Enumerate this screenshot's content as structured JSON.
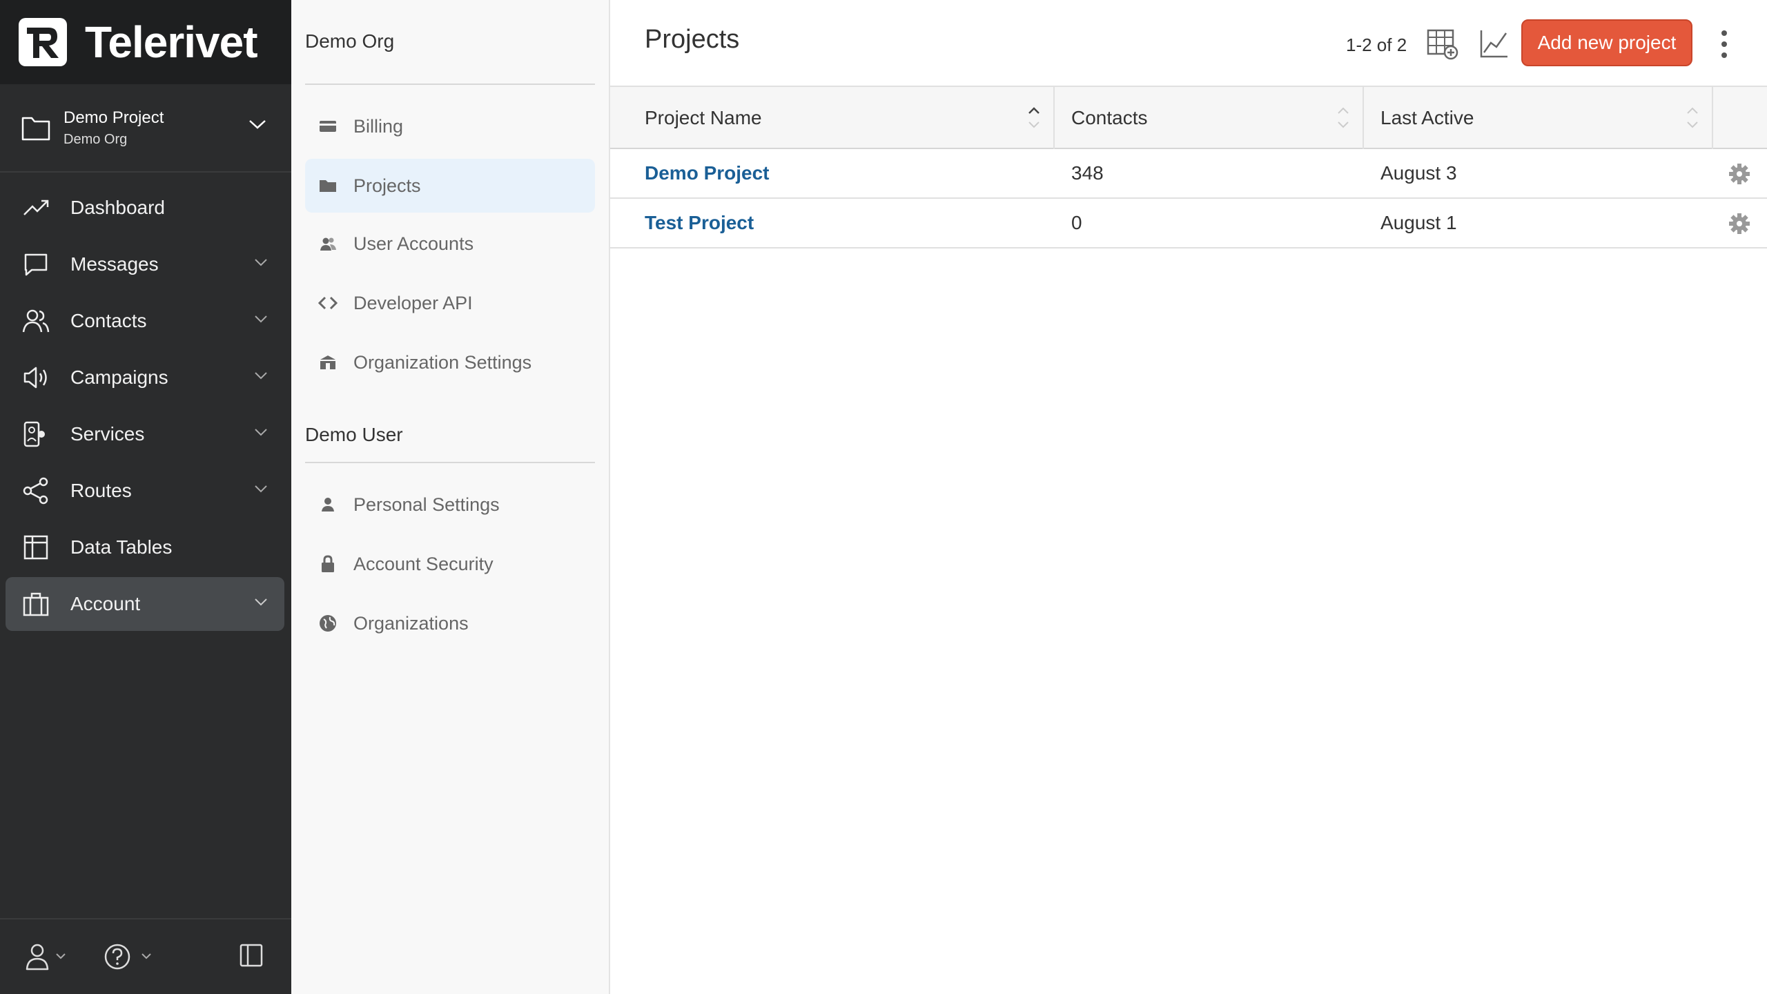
{
  "brand": {
    "name": "Telerivet"
  },
  "project_switcher": {
    "project": "Demo Project",
    "org": "Demo Org"
  },
  "nav": [
    {
      "label": "Dashboard",
      "icon": "trending-up-icon",
      "chevron": false
    },
    {
      "label": "Messages",
      "icon": "chat-icon",
      "chevron": true
    },
    {
      "label": "Contacts",
      "icon": "users-icon",
      "chevron": true
    },
    {
      "label": "Campaigns",
      "icon": "megaphone-icon",
      "chevron": true
    },
    {
      "label": "Services",
      "icon": "services-icon",
      "chevron": true
    },
    {
      "label": "Routes",
      "icon": "share-icon",
      "chevron": true
    },
    {
      "label": "Data Tables",
      "icon": "table-icon",
      "chevron": false
    },
    {
      "label": "Account",
      "icon": "briefcase-icon",
      "chevron": true,
      "active": true
    }
  ],
  "settings": {
    "org_section": "Demo Org",
    "org_items": [
      {
        "label": "Billing",
        "icon": "credit-card-icon"
      },
      {
        "label": "Projects",
        "icon": "folder-icon",
        "active": true
      },
      {
        "label": "User Accounts",
        "icon": "user-group-icon"
      },
      {
        "label": "Developer API",
        "icon": "code-icon"
      },
      {
        "label": "Organization Settings",
        "icon": "building-icon"
      }
    ],
    "user_section": "Demo User",
    "user_items": [
      {
        "label": "Personal Settings",
        "icon": "person-icon"
      },
      {
        "label": "Account Security",
        "icon": "lock-icon"
      },
      {
        "label": "Organizations",
        "icon": "globe-icon"
      }
    ]
  },
  "main": {
    "title": "Projects",
    "pager": "1-2 of 2",
    "add_button": "Add new project",
    "columns": [
      "Project Name",
      "Contacts",
      "Last Active"
    ],
    "rows": [
      {
        "name": "Demo Project",
        "contacts": "348",
        "last_active": "August 3"
      },
      {
        "name": "Test Project",
        "contacts": "0",
        "last_active": "August 1"
      }
    ]
  },
  "colors": {
    "accent": "#e4583b",
    "link": "#1a5f96",
    "sidebar": "#2b2c2d"
  }
}
